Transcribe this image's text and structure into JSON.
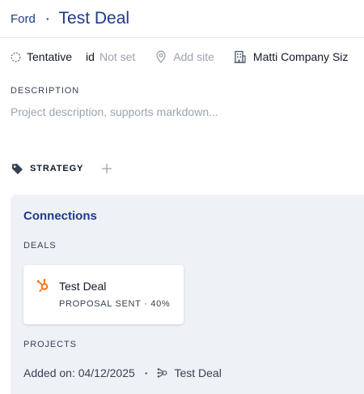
{
  "breadcrumb": {
    "parent": "Ford",
    "separator": "·",
    "title": "Test Deal"
  },
  "meta": {
    "status": "Tentative",
    "status_icon": "dashed-circle-icon",
    "id_label": "id",
    "id_value": "Not set",
    "site_icon": "map-pin-icon",
    "site_placeholder": "Add site",
    "company_icon": "building-icon",
    "company": "Matti Company Siz"
  },
  "description": {
    "label": "DESCRIPTION",
    "placeholder": "Project description, supports markdown..."
  },
  "strategy": {
    "label": "STRATEGY",
    "tag_icon": "tag-icon",
    "add_icon": "plus-icon"
  },
  "connections": {
    "title": "Connections",
    "deals_label": "DEALS",
    "deals": [
      {
        "icon": "hubspot-icon",
        "name": "Test Deal",
        "status": "PROPOSAL SENT · 40%"
      }
    ],
    "projects_label": "PROJECTS",
    "project": {
      "added_on": "Added on: 04/12/2025",
      "separator": "·",
      "link_icon": "deal-link-icon",
      "deal_name": "Test Deal"
    }
  },
  "colors": {
    "accent": "#1e3a8a",
    "panel_bg": "#eef2f7",
    "hubspot": "#f97316",
    "muted": "#9ca3af"
  }
}
